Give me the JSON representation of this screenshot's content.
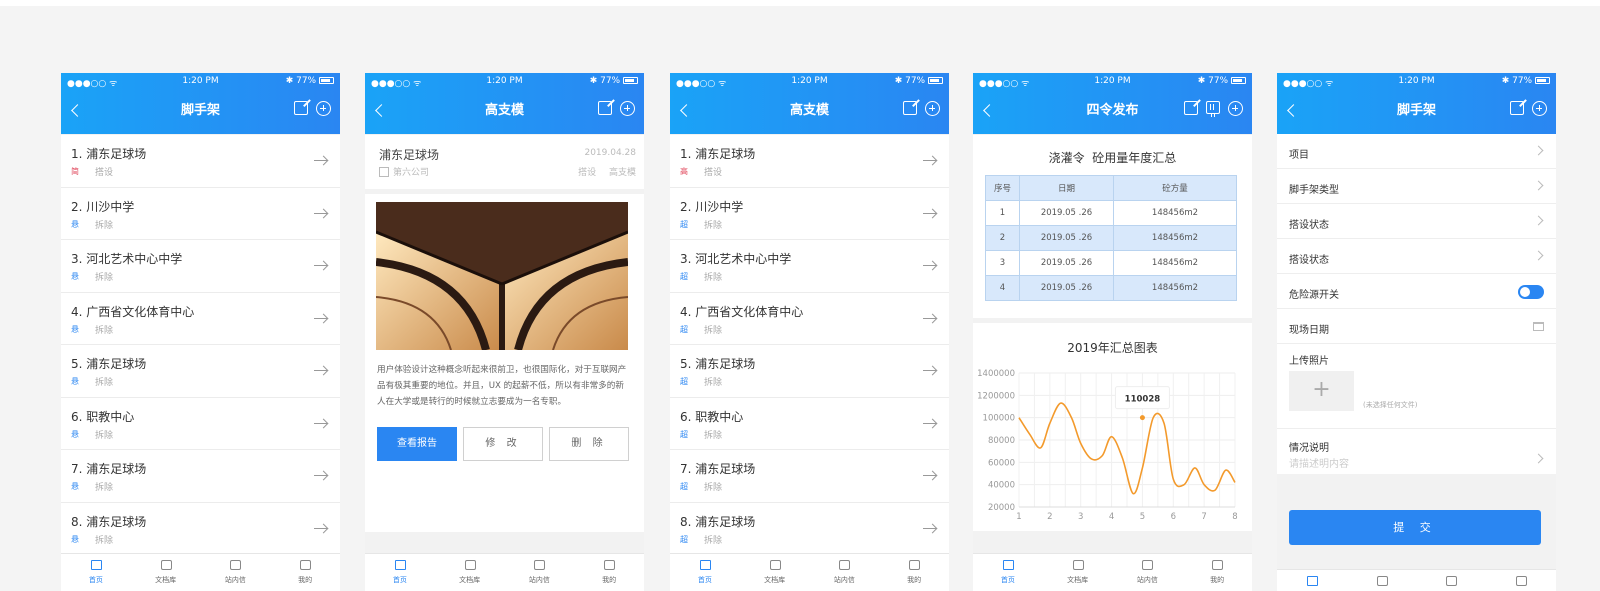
{
  "status": {
    "time": "1:20 PM",
    "battery": "77%"
  },
  "tabs": [
    "首页",
    "文档库",
    "站内信",
    "我的"
  ],
  "colors": {
    "primary": "#2a86f2",
    "badge_red": "#e0455a",
    "badge_blue": "#2a86f2"
  },
  "screen1": {
    "title": "脚手架",
    "items": [
      {
        "name": "1. 浦东足球场",
        "badge": "简",
        "sub": "搭设",
        "red": true
      },
      {
        "name": "2. 川沙中学",
        "badge": "悬",
        "sub": "拆除"
      },
      {
        "name": "3. 河北艺术中心中学",
        "badge": "悬",
        "sub": "拆除"
      },
      {
        "name": "4. 广西省文化体育中心",
        "badge": "悬",
        "sub": "拆除"
      },
      {
        "name": "5. 浦东足球场",
        "badge": "悬",
        "sub": "拆除"
      },
      {
        "name": "6. 职教中心",
        "badge": "悬",
        "sub": "拆除"
      },
      {
        "name": "7. 浦东足球场",
        "badge": "悬",
        "sub": "拆除"
      },
      {
        "name": "8. 浦东足球场",
        "badge": "悬",
        "sub": "拆除"
      }
    ]
  },
  "screen2": {
    "title": "高支模",
    "project": "浦东足球场",
    "date": "2019.04.28",
    "company": "第六公司",
    "tags": "搭设 高支模",
    "description": "用户体验设计这种概念听起来很前卫，也很国际化，对于互联网产品有极其重要的地位。并且，UX 的起薪不低，所以有非常多的新人在大学或是转行的时候就立志要成为一名专职。",
    "buttons": {
      "report": "查看报告",
      "edit": "修 改",
      "delete": "删 除"
    }
  },
  "screen3": {
    "title": "高支模",
    "items": [
      {
        "name": "1. 浦东足球场",
        "badge": "高",
        "sub": "搭设",
        "red": true
      },
      {
        "name": "2. 川沙中学",
        "badge": "超",
        "sub": "拆除"
      },
      {
        "name": "3. 河北艺术中心中学",
        "badge": "超",
        "sub": "拆除"
      },
      {
        "name": "4. 广西省文化体育中心",
        "badge": "超",
        "sub": "拆除"
      },
      {
        "name": "5. 浦东足球场",
        "badge": "超",
        "sub": "拆除"
      },
      {
        "name": "6. 职教中心",
        "badge": "超",
        "sub": "拆除"
      },
      {
        "name": "7. 浦东足球场",
        "badge": "超",
        "sub": "拆除"
      },
      {
        "name": "8. 浦东足球场",
        "badge": "超",
        "sub": "拆除"
      }
    ]
  },
  "screen4": {
    "title": "四令发布",
    "table_title": "浇灌令  砼用量年度汇总",
    "table_headers": [
      "序号",
      "日期",
      "砼方量"
    ],
    "table_rows": [
      [
        "1",
        "2019.05 .26",
        "148456m2"
      ],
      [
        "2",
        "2019.05 .26",
        "148456m2"
      ],
      [
        "3",
        "2019.05 .26",
        "148456m2"
      ],
      [
        "4",
        "2019.05 .26",
        "148456m2"
      ]
    ],
    "chart_title": "2019年汇总图表",
    "tooltip": "110028"
  },
  "chart_data": {
    "type": "line",
    "title": "2019年汇总图表",
    "x": [
      1,
      1.35,
      1.7,
      2,
      2.35,
      2.7,
      3,
      3.35,
      3.7,
      4,
      4.35,
      4.7,
      5,
      5.35,
      5.7,
      6,
      6.35,
      6.7,
      7,
      7.35,
      7.7,
      8
    ],
    "y": [
      100000,
      85000,
      73000,
      95000,
      113000,
      100000,
      77000,
      63000,
      66000,
      83000,
      64000,
      32000,
      55000,
      100000,
      95000,
      45000,
      40000,
      55000,
      40000,
      35000,
      53000,
      42000
    ],
    "xticks": [
      1,
      2,
      3,
      4,
      5,
      6,
      7,
      8
    ],
    "yticks": [
      20000,
      40000,
      60000,
      80000,
      100000,
      120000,
      140000
    ],
    "ytick_labels": [
      "20000",
      "40000",
      "60000",
      "80000",
      "100000",
      "1200000",
      "1400000"
    ],
    "xlim": [
      1,
      8
    ],
    "ylim": [
      20000,
      140000
    ],
    "grid": true,
    "highlight": {
      "x": 5,
      "label": "110028"
    },
    "color": "#f39a2c"
  },
  "screen5": {
    "title": "脚手架",
    "rows": [
      {
        "label": "项目",
        "control": "chevron"
      },
      {
        "label": "脚手架类型",
        "control": "chevron"
      },
      {
        "label": "搭设状态",
        "control": "chevron"
      },
      {
        "label": "搭设状态",
        "control": "chevron"
      },
      {
        "label": "危险源开关",
        "control": "toggle"
      },
      {
        "label": "现场日期",
        "control": "calendar"
      }
    ],
    "upload_label": "上传照片",
    "upload_note": "(未选择任何文件)",
    "explain_label": "情况说明",
    "explain_placeholder": "请描述明内容",
    "submit": "提 交"
  }
}
